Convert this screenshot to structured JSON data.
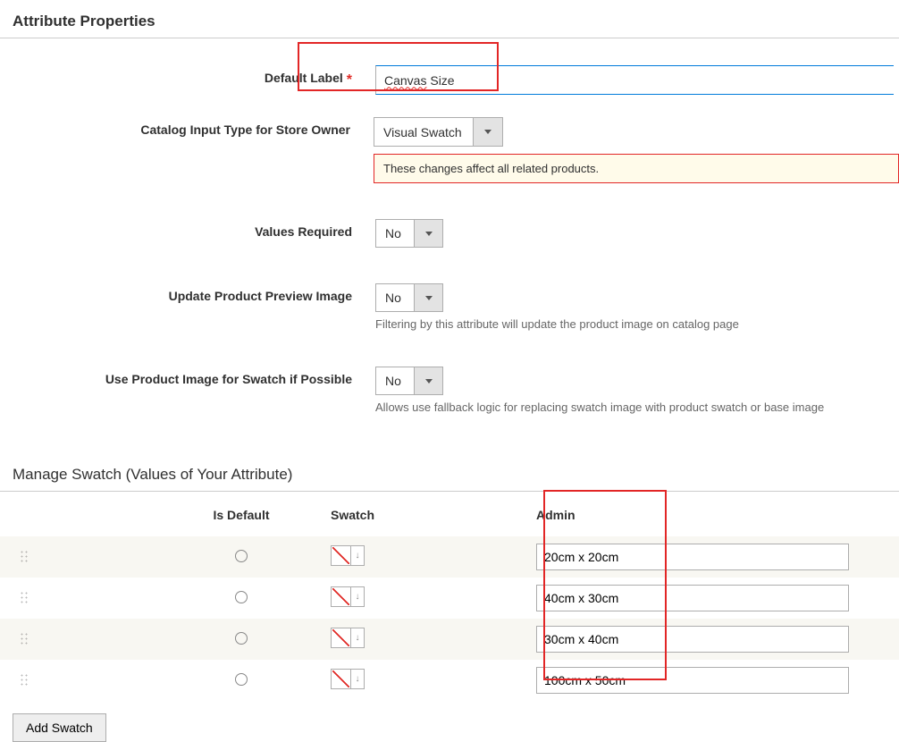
{
  "sections": {
    "attribute_properties_title": "Attribute Properties",
    "manage_swatch_title": "Manage Swatch (Values of Your Attribute)"
  },
  "fields": {
    "default_label": {
      "label": "Default Label",
      "value": "Canvas Size",
      "spelling_word": "Canvas",
      "rest": " Size"
    },
    "catalog_input_type": {
      "label": "Catalog Input Type for Store Owner",
      "value": "Visual Swatch",
      "warning": "These changes affect all related products."
    },
    "values_required": {
      "label": "Values Required",
      "value": "No"
    },
    "update_preview": {
      "label": "Update Product Preview Image",
      "value": "No",
      "hint": "Filtering by this attribute will update the product image on catalog page"
    },
    "use_product_image": {
      "label": "Use Product Image for Swatch if Possible",
      "value": "No",
      "hint": "Allows use fallback logic for replacing swatch image with product swatch or base image"
    }
  },
  "swatch_table": {
    "headers": {
      "is_default": "Is Default",
      "swatch": "Swatch",
      "admin": "Admin"
    },
    "rows": [
      {
        "admin": "20cm x 20cm"
      },
      {
        "admin": "40cm x 30cm"
      },
      {
        "admin": "30cm x 40cm"
      },
      {
        "admin": "100cm x 50cm"
      }
    ]
  },
  "buttons": {
    "add_swatch": "Add Swatch"
  }
}
